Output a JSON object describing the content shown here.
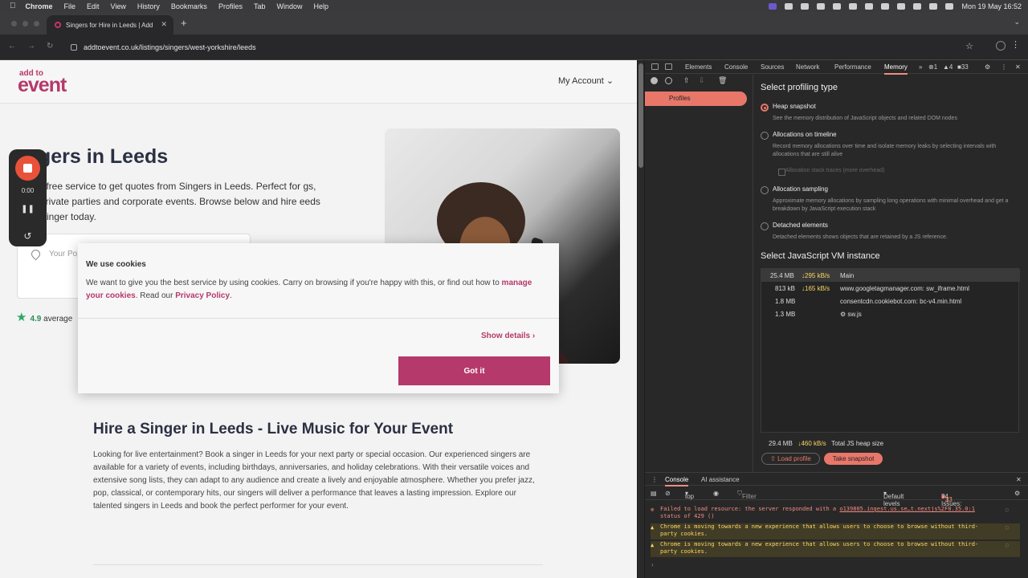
{
  "menubar": {
    "items": [
      "Chrome",
      "File",
      "Edit",
      "View",
      "History",
      "Bookmarks",
      "Profiles",
      "Tab",
      "Window",
      "Help"
    ],
    "clock": "Mon 19 May  16:52"
  },
  "browser": {
    "tab_title": "Singers for Hire in Leeds | Add",
    "url": "addtoevent.co.uk/listings/singers/west-yorkshire/leeds"
  },
  "site": {
    "logo_top": "add to",
    "logo_main": "event",
    "account": "My Account",
    "title": "gers in Leeds",
    "intro": "r free service to get quotes from Singers in Leeds. Perfect for gs, private parties and corporate events. Browse below and hire eeds Singer today.",
    "postcode_placeholder": "Your Po",
    "rating_value": "4.9",
    "rating_text": "average",
    "section_heading": "Hire a Singer in Leeds - Live Music for Your Event",
    "section_body": "Looking for live entertainment? Book a singer in Leeds for your next party or special occasion. Our experienced singers are available for a variety of events, including birthdays, anniversaries, and holiday celebrations. With their versatile voices and extensive song lists, they can adapt to any audience and create a lively and enjoyable atmosphere. Whether you prefer jazz, pop, classical, or contemporary hits, our singers will deliver a performance that leaves a lasting impression. Explore our talented singers in Leeds and book the perfect performer for your event."
  },
  "recorder": {
    "time": "0:00"
  },
  "cookie": {
    "title": "We use cookies",
    "text_before": "We want to give you the best service by using cookies. Carry on browsing if you're happy with this, or find out how to",
    "link1": "manage your cookies",
    "text_mid": ". Read our",
    "link2": "Privacy Policy",
    "text_end": ".",
    "show_details": "Show details",
    "got_it": "Got it"
  },
  "devtools": {
    "tabs": [
      "Elements",
      "Console",
      "Sources",
      "Network",
      "Performance",
      "Memory"
    ],
    "errors": "1",
    "warnings": "4",
    "issues": "33",
    "profiles_label": "Profiles",
    "select_type": "Select profiling type",
    "options": [
      {
        "label": "Heap snapshot",
        "desc": "See the memory distribution of JavaScript objects and related DOM nodes",
        "selected": true
      },
      {
        "label": "Allocations on timeline",
        "desc": "Record memory allocations over time and isolate memory leaks by selecting intervals with allocations that are still alive",
        "selected": false
      },
      {
        "label": "Allocation sampling",
        "desc": "Approximate memory allocations by sampling long operations with minimal overhead and get a breakdown by JavaScript execution stack",
        "selected": false
      },
      {
        "label": "Detached elements",
        "desc": "Detached elements shows objects that are retained by a JS reference.",
        "selected": false
      }
    ],
    "alloc_stack_label": "Allocation stack traces (more overhead)",
    "select_vm": "Select JavaScript VM instance",
    "vm_rows": [
      {
        "size": "25.4 MB",
        "rate": "↓295 kB/s",
        "name": "Main"
      },
      {
        "size": "813 kB",
        "rate": "↓165 kB/s",
        "name": "www.googletagmanager.com: sw_iframe.html"
      },
      {
        "size": "1.8 MB",
        "rate": "",
        "name": "consentcdn.cookiebot.com: bc-v4.min.html"
      },
      {
        "size": "1.3 MB",
        "rate": "",
        "name": "⚙ sw.js"
      }
    ],
    "total_size": "29.4 MB",
    "total_rate": "↓460 kB/s",
    "total_label": "Total JS heap size",
    "load_profile": "Load profile",
    "take_snapshot": "Take snapshot",
    "drawer_tabs": [
      "Console",
      "AI assistance"
    ],
    "context": "top",
    "filter_placeholder": "Filter",
    "levels": "Default levels",
    "issues_label": "34 Issues:",
    "console_messages": [
      {
        "type": "error",
        "text": "Failed to load resource: the server responded with a",
        "link": "o139805.ingest.us.se…t.nextjs%2F8.35.0:1",
        "text2": "status of 429 ()"
      },
      {
        "type": "warning",
        "text": "Chrome is moving towards a new experience that allows users to choose to browse without third-party cookies."
      },
      {
        "type": "warning",
        "text": "Chrome is moving towards a new experience that allows users to choose to browse without third-party cookies."
      }
    ]
  }
}
